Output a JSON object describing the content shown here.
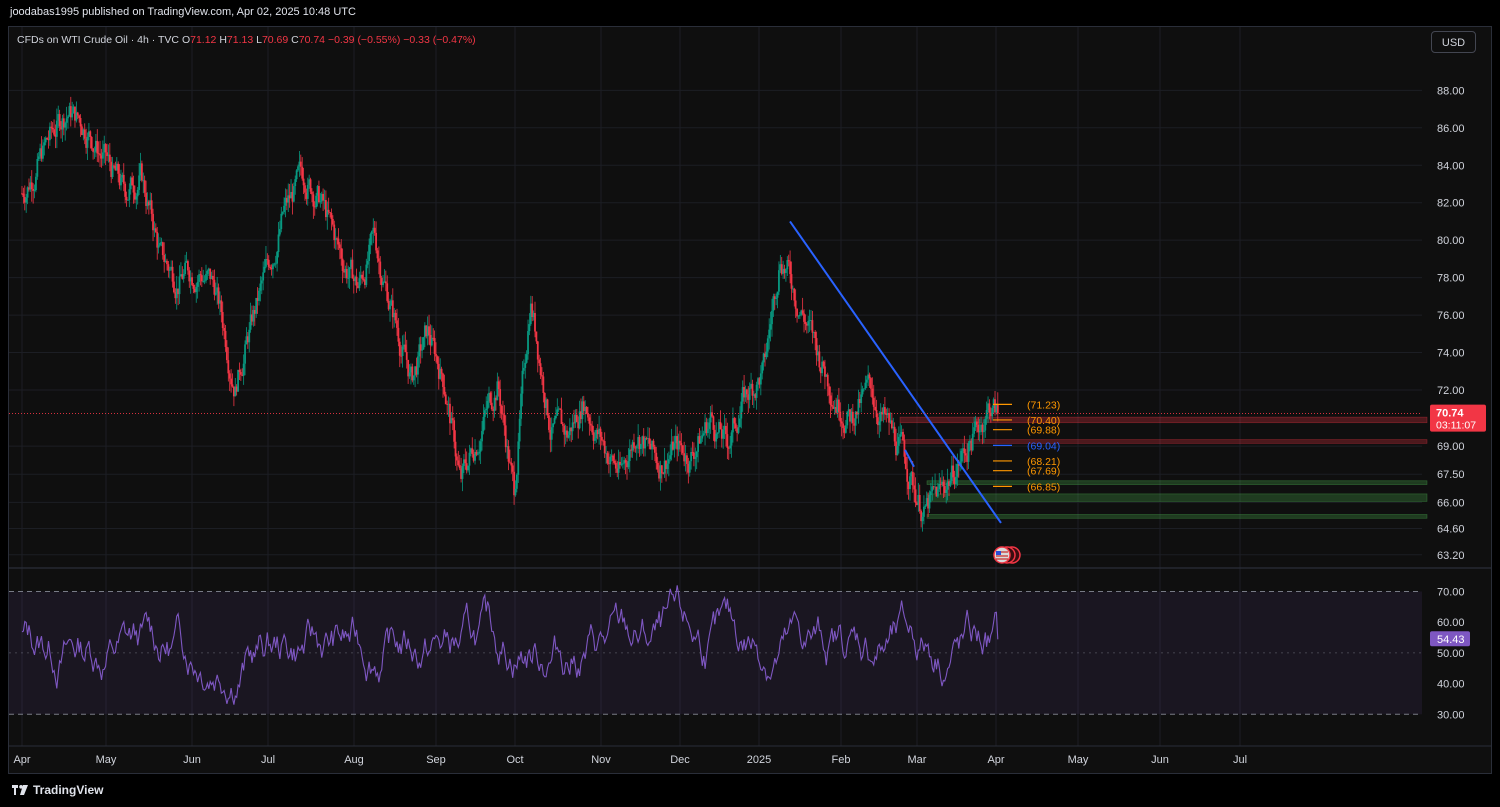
{
  "header": {
    "publisher": "joodabas1995 published on TradingView.com, Apr 02, 2025 10:48 UTC"
  },
  "legend": {
    "symbol": "CFDs on WTI Crude Oil · 4h · TVC",
    "open_label": "O",
    "open": "71.12",
    "high_label": "H",
    "high": "71.13",
    "low_label": "L",
    "low": "70.69",
    "close_label": "C",
    "close": "70.74",
    "change": "−0.39 (−0.55%)",
    "change2": "−0.33 (−0.47%)"
  },
  "currency": "USD",
  "footer": {
    "brand": "TradingView"
  },
  "colors": {
    "up": "#089981",
    "down": "#f23645",
    "trendline": "#2962ff",
    "level_orange": "#ff9800",
    "level_blue": "#2962ff",
    "rsi_line": "#7e57c2"
  },
  "chart_data": [
    {
      "type": "candlestick",
      "interval": "4h",
      "x_labels": [
        "Apr",
        "May",
        "Jun",
        "Jul",
        "Aug",
        "Sep",
        "Oct",
        "Nov",
        "Dec",
        "2025",
        "Feb",
        "Mar",
        "Apr",
        "May",
        "Jun",
        "Jul"
      ],
      "y_ticks": [
        "88.00",
        "86.00",
        "84.00",
        "82.00",
        "80.00",
        "78.00",
        "76.00",
        "74.00",
        "72.00",
        "69.00",
        "67.50",
        "66.00",
        "64.60",
        "63.20"
      ],
      "ylim": [
        62.6,
        89.3
      ],
      "price_path": [
        [
          0,
          82.5
        ],
        [
          7,
          85.5
        ],
        [
          11,
          87.0
        ],
        [
          16,
          86.0
        ],
        [
          21,
          84.0
        ],
        [
          25,
          82.5
        ],
        [
          29,
          83.5
        ],
        [
          34,
          79.0
        ],
        [
          38,
          78.0
        ],
        [
          43,
          78.5
        ],
        [
          47,
          77.5
        ],
        [
          52,
          72.5
        ],
        [
          56,
          75.5
        ],
        [
          60,
          78.5
        ],
        [
          64,
          81.5
        ],
        [
          69,
          83.5
        ],
        [
          73,
          82.0
        ],
        [
          78,
          79.0
        ],
        [
          82,
          77.5
        ],
        [
          86,
          80.0
        ],
        [
          90,
          76.5
        ],
        [
          95,
          72.5
        ],
        [
          99,
          75.0
        ],
        [
          103,
          72.5
        ],
        [
          107,
          67.0
        ],
        [
          111,
          69.5
        ],
        [
          116,
          72.5
        ],
        [
          120,
          66.5
        ],
        [
          124,
          77.0
        ],
        [
          129,
          70.0
        ],
        [
          133,
          69.5
        ],
        [
          137,
          71.5
        ],
        [
          142,
          69.0
        ],
        [
          146,
          67.5
        ],
        [
          150,
          70.0
        ],
        [
          155,
          68.0
        ],
        [
          159,
          69.0
        ],
        [
          163,
          68.5
        ],
        [
          168,
          70.5
        ],
        [
          172,
          69.0
        ],
        [
          176,
          71.5
        ],
        [
          181,
          73.0
        ],
        [
          185,
          79.5
        ],
        [
          189,
          77.0
        ],
        [
          194,
          74.0
        ],
        [
          198,
          72.0
        ],
        [
          202,
          70.5
        ],
        [
          207,
          72.0
        ],
        [
          211,
          70.0
        ],
        [
          215,
          68.5
        ],
        [
          220,
          65.5
        ],
        [
          224,
          66.5
        ],
        [
          228,
          68.0
        ],
        [
          232,
          69.5
        ],
        [
          236,
          71.2
        ],
        [
          238,
          70.74
        ]
      ],
      "last_price": "70.74",
      "countdown": "03:11:07",
      "trendlines": [
        {
          "from": [
            "Jan 15 2025",
            81.0
          ],
          "to": [
            "Apr 02 2025",
            64.9
          ]
        },
        {
          "from": [
            "Feb 28 2025",
            68.8
          ],
          "to": [
            "Mar 03 2025",
            67.9
          ]
        }
      ],
      "levels": [
        {
          "label": "(71.23)",
          "value": 71.23,
          "color": "orange"
        },
        {
          "label": "(70.40)",
          "value": 70.4,
          "color": "orange"
        },
        {
          "label": "(69.88)",
          "value": 69.88,
          "color": "orange"
        },
        {
          "label": "(69.04)",
          "value": 69.04,
          "color": "blue"
        },
        {
          "label": "(68.21)",
          "value": 68.21,
          "color": "orange"
        },
        {
          "label": "(67.69)",
          "value": 67.69,
          "color": "orange"
        },
        {
          "label": "(66.85)",
          "value": 66.85,
          "color": "orange"
        }
      ],
      "zones": [
        {
          "low": 70.25,
          "high": 70.55,
          "kind": "resistance"
        },
        {
          "low": 69.15,
          "high": 69.35,
          "kind": "resistance"
        },
        {
          "low": 66.95,
          "high": 67.15,
          "kind": "support"
        },
        {
          "low": 66.05,
          "high": 66.45,
          "kind": "support"
        },
        {
          "low": 65.15,
          "high": 65.35,
          "kind": "support"
        }
      ]
    },
    {
      "type": "line",
      "name": "RSI",
      "y_ticks": [
        "70.00",
        "60.00",
        "50.00",
        "40.00",
        "30.00"
      ],
      "ylim": [
        20,
        77
      ],
      "band": [
        30,
        70
      ],
      "last_value": "54.43"
    }
  ]
}
